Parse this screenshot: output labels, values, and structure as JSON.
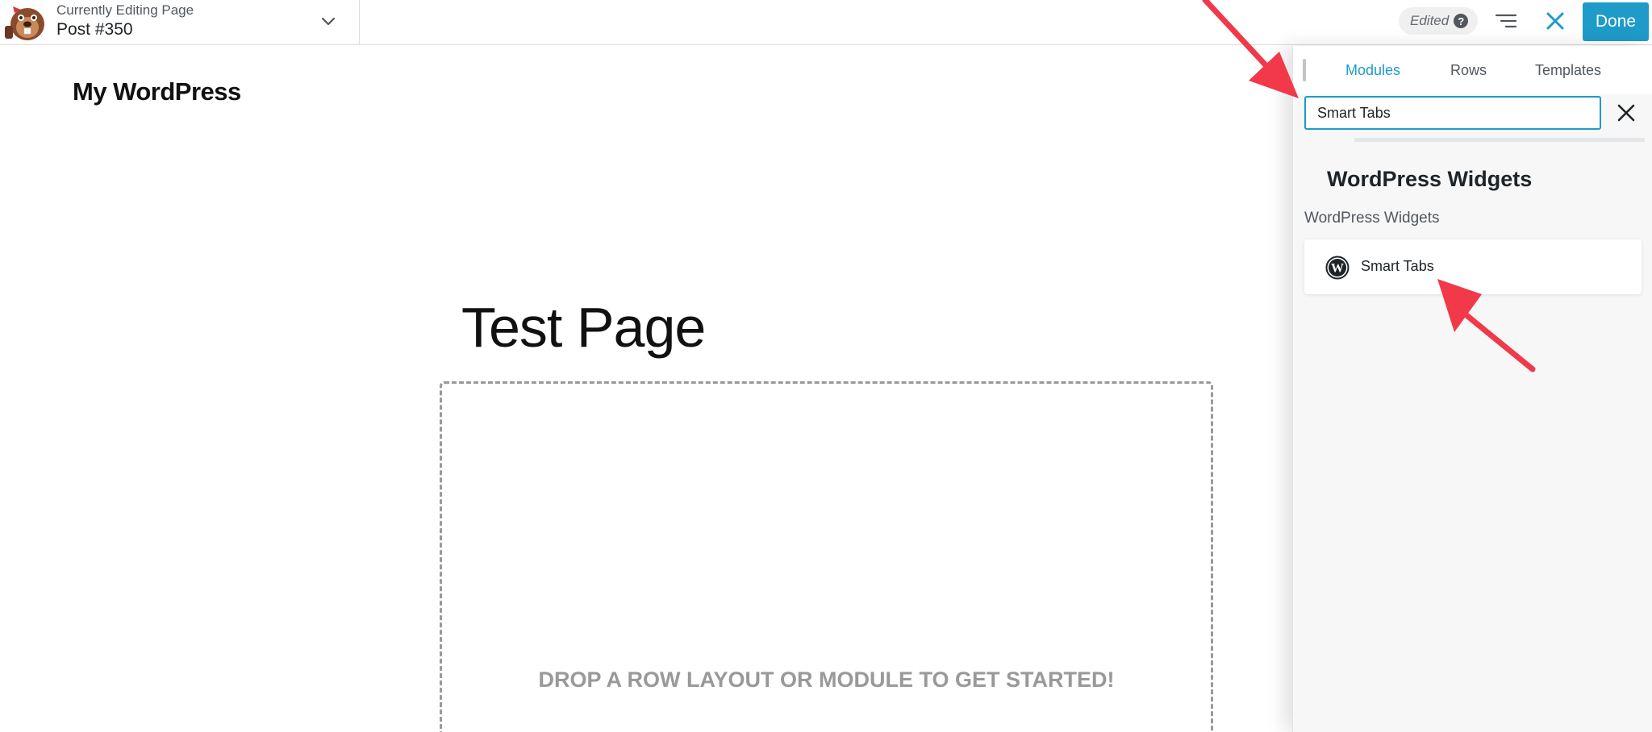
{
  "colors": {
    "accent": "#1e9bc9",
    "annotation": "#f1394a",
    "panel_background": "#f7f7f7",
    "drop_zone_text": "#999999"
  },
  "toolbar": {
    "editing_label": "Currently Editing Page",
    "post_label": "Post #350",
    "edited_label": "Edited",
    "help_icon": "?",
    "done_label": "Done",
    "icons": [
      "beaver-logo",
      "chevron-down-icon",
      "help-icon",
      "outline-icon",
      "close-icon"
    ]
  },
  "canvas": {
    "site_title": "My WordPress",
    "page_heading": "Test Page",
    "drop_message": "DROP A ROW LAYOUT OR MODULE TO GET STARTED!"
  },
  "panel": {
    "tabs": [
      {
        "label": "Modules",
        "active": true
      },
      {
        "label": "Rows",
        "active": false
      },
      {
        "label": "Templates",
        "active": false
      }
    ],
    "search": {
      "value": "Smart Tabs",
      "placeholder": ""
    },
    "group_heading": "WordPress Widgets",
    "group_subheading": "WordPress Widgets",
    "modules": [
      {
        "label": "Smart Tabs",
        "icon": "wordpress-icon"
      }
    ]
  }
}
